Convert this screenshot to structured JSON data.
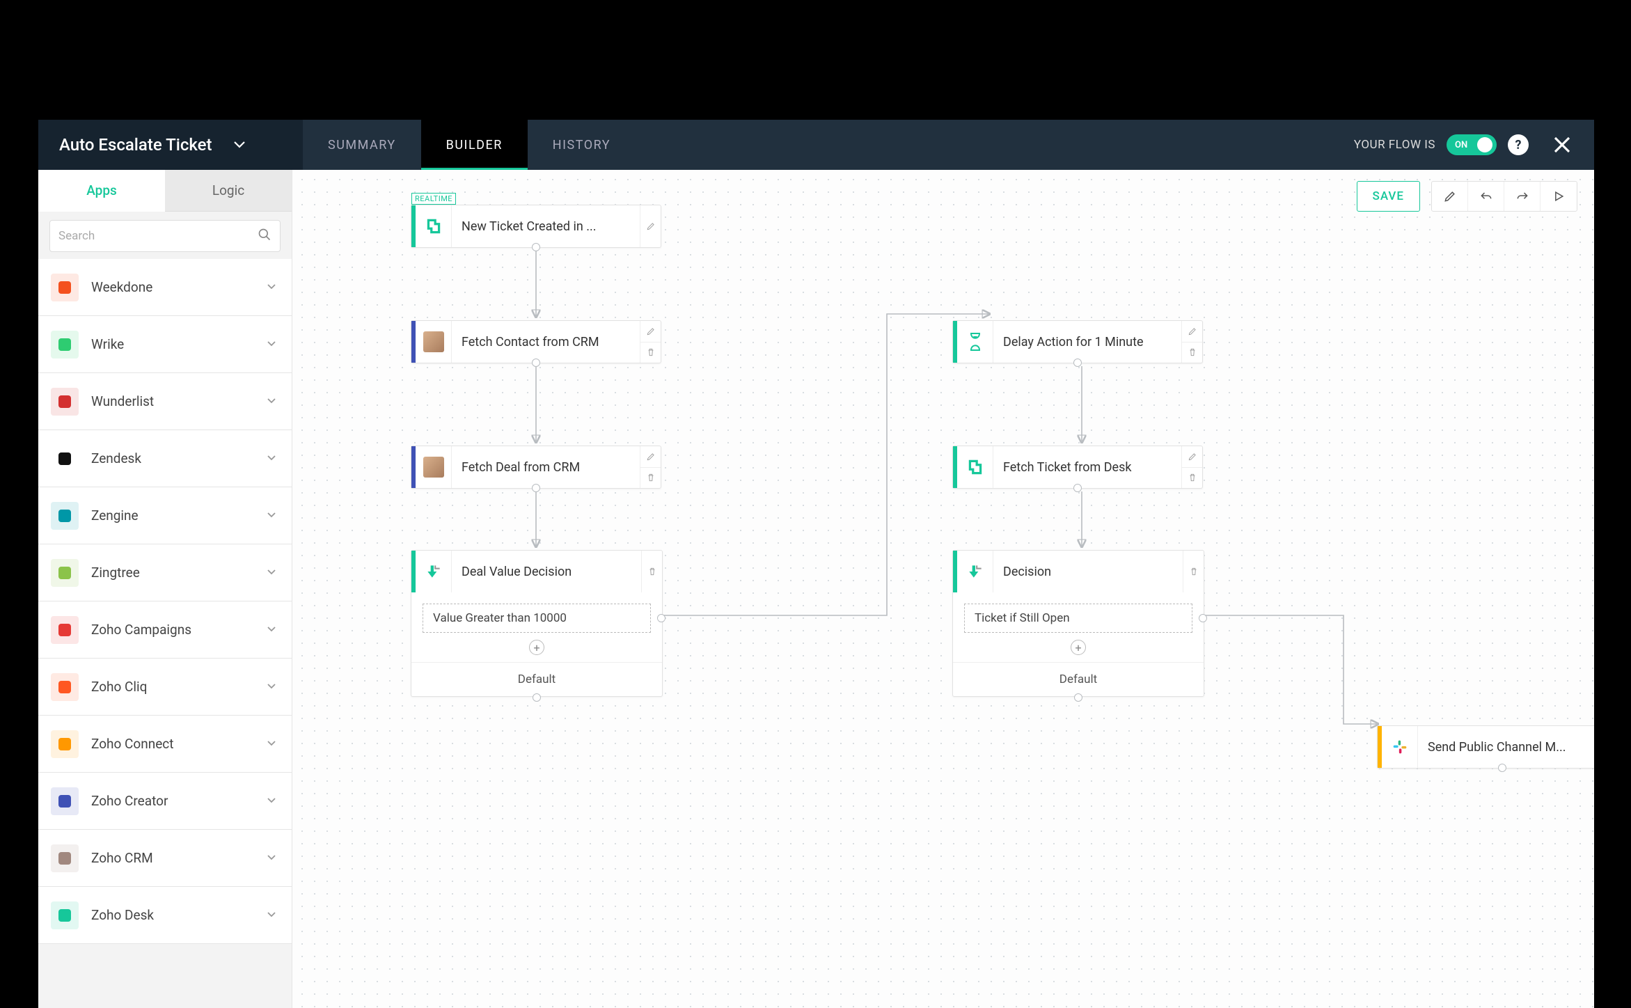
{
  "header": {
    "flow_title": "Auto Escalate Ticket",
    "tabs": {
      "summary": "SUMMARY",
      "builder": "BUILDER",
      "history": "HISTORY"
    },
    "active_tab": "builder",
    "status_label": "YOUR FLOW IS",
    "toggle_text": "ON",
    "save_label": "SAVE"
  },
  "sidebar": {
    "tabs": {
      "apps": "Apps",
      "logic": "Logic"
    },
    "active_tab": "apps",
    "search_placeholder": "Search",
    "apps": [
      {
        "name": "Weekdone",
        "color": "#f4511e"
      },
      {
        "name": "Wrike",
        "color": "#2ecc71"
      },
      {
        "name": "Wunderlist",
        "color": "#d32f2f"
      },
      {
        "name": "Zendesk",
        "color": "#111"
      },
      {
        "name": "Zengine",
        "color": "#0097a7"
      },
      {
        "name": "Zingtree",
        "color": "#8bc34a"
      },
      {
        "name": "Zoho Campaigns",
        "color": "#e53935"
      },
      {
        "name": "Zoho Cliq",
        "color": "#ff5722"
      },
      {
        "name": "Zoho Connect",
        "color": "#ff9800"
      },
      {
        "name": "Zoho Creator",
        "color": "#3f51b5"
      },
      {
        "name": "Zoho CRM",
        "color": "#a1887f"
      },
      {
        "name": "Zoho Desk",
        "color": "#16c79a"
      }
    ]
  },
  "canvas": {
    "nodes": {
      "trigger": {
        "label": "New Ticket Created in ...",
        "tag": "REALTIME"
      },
      "fetch_contact": {
        "label": "Fetch Contact from CRM"
      },
      "fetch_deal": {
        "label": "Fetch Deal from CRM"
      },
      "deal_decision": {
        "label": "Deal Value Decision",
        "condition": "Value Greater than 10000",
        "default": "Default"
      },
      "delay": {
        "label": "Delay Action for 1 Minute"
      },
      "fetch_ticket": {
        "label": "Fetch Ticket from Desk"
      },
      "ticket_decision": {
        "label": "Decision",
        "condition": "Ticket if Still Open",
        "default": "Default"
      },
      "slack": {
        "label": "Send Public Channel M..."
      }
    }
  }
}
